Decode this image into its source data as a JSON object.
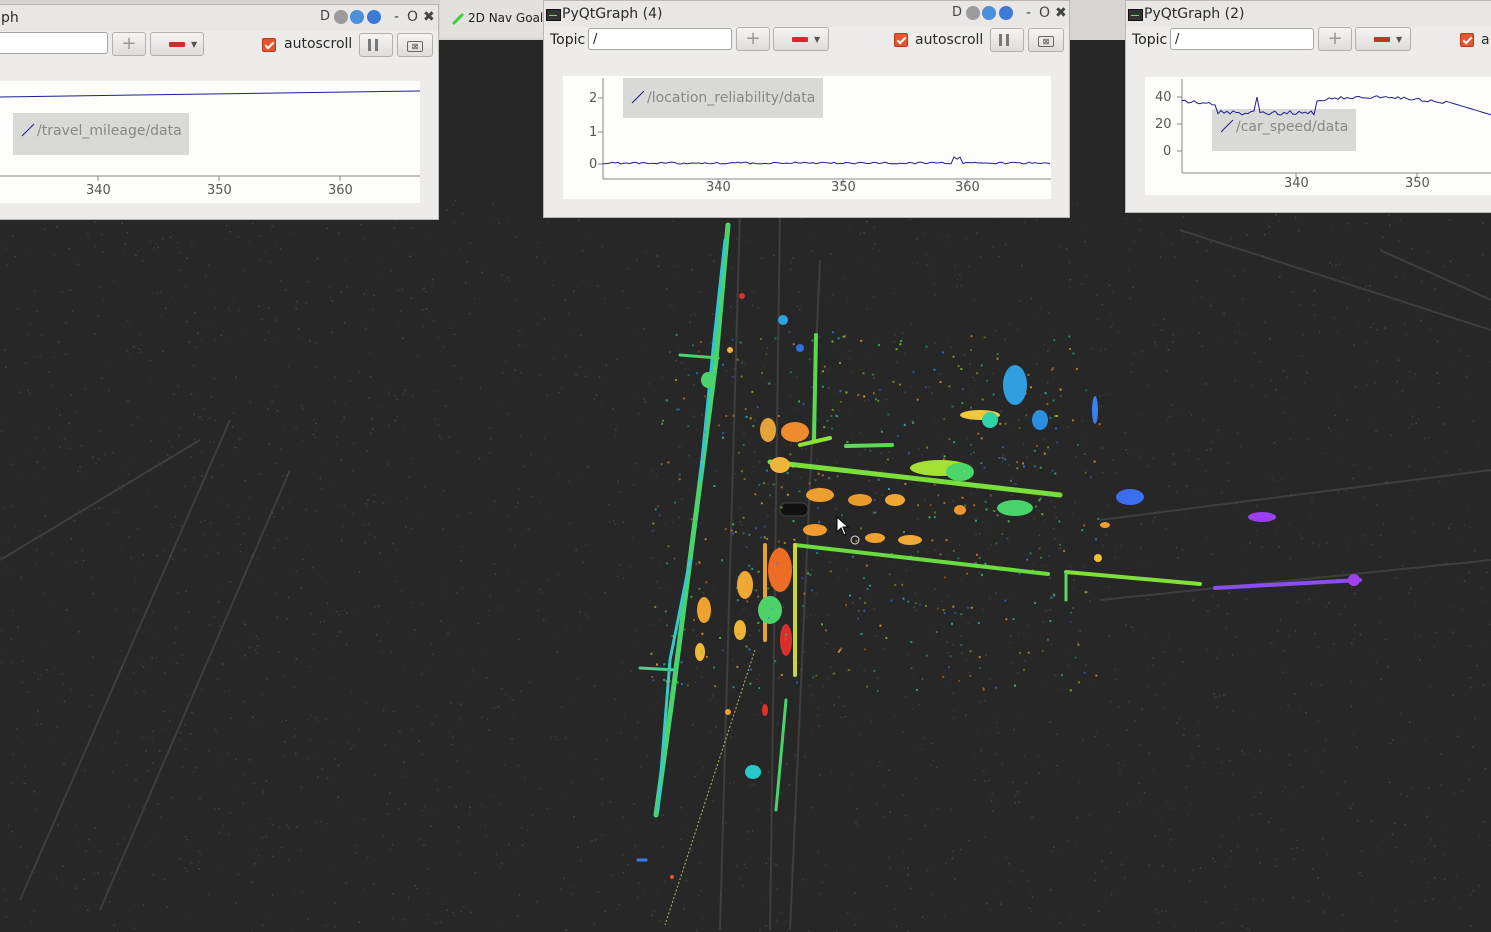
{
  "toolbar": {
    "nav_goal_label": "2D Nav Goal"
  },
  "windows": [
    {
      "title": "ph",
      "topic_value": "",
      "autoscroll_label": "autoscroll",
      "autoscroll_checked": true,
      "legend": "/travel_mileage/data",
      "x_ticks": [
        "340",
        "350",
        "360"
      ],
      "y_ticks": []
    },
    {
      "title": "PyQtGraph (4)",
      "topic_label": "Topic",
      "topic_value": "/",
      "autoscroll_label": "autoscroll",
      "autoscroll_checked": true,
      "legend": "/location_reliability/data",
      "x_ticks": [
        "340",
        "350",
        "360"
      ],
      "y_ticks": [
        "2",
        "1",
        "0"
      ]
    },
    {
      "title": "PyQtGraph (2)",
      "topic_label": "Topic",
      "topic_value": "/",
      "autoscroll_label": "a",
      "autoscroll_checked": true,
      "legend": "/car_speed/data",
      "x_ticks": [
        "340",
        "350"
      ],
      "y_ticks": [
        "40",
        "20",
        "0"
      ]
    }
  ],
  "colors": {
    "background": "#272727",
    "plot_line": "#1f1f8f",
    "checkbox": "#e4572e",
    "window": "#edeceb"
  }
}
